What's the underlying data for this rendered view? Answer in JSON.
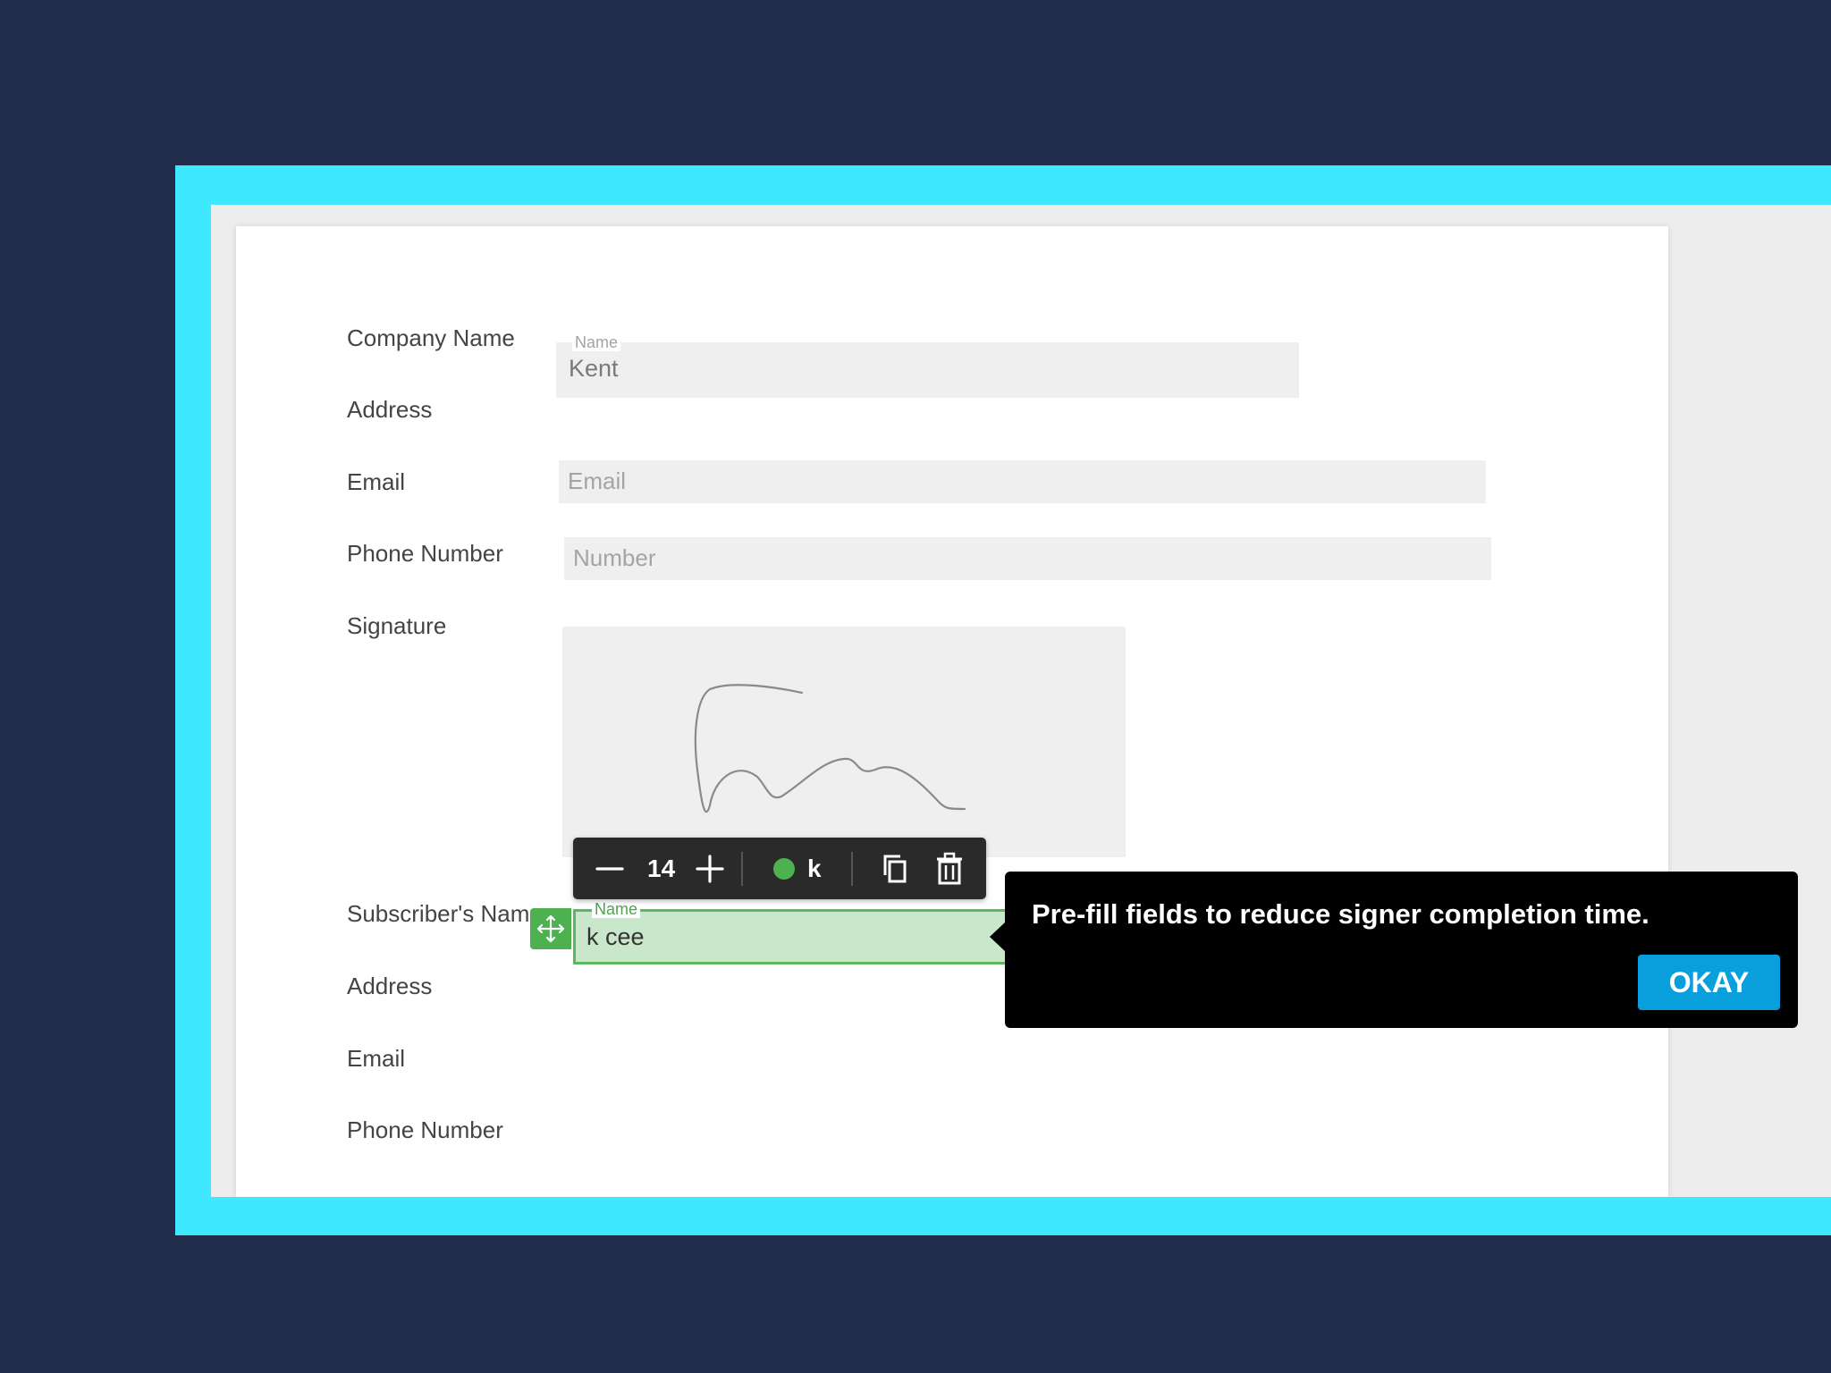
{
  "form": {
    "company_name_label": "Company Name",
    "company_field": {
      "caption": "Name",
      "value": "Kent"
    },
    "address_label": "Address",
    "email_label": "Email",
    "email_field": {
      "placeholder": "Email"
    },
    "phone_label": "Phone Number",
    "phone_field": {
      "placeholder": "Number"
    },
    "signature_label": "Signature",
    "subscriber_name_label": "Subscriber's Name",
    "subscriber_address_label": "Address",
    "subscriber_email_label": "Email",
    "subscriber_phone_label": "Phone Number"
  },
  "toolbar": {
    "font_size": "14",
    "signer_initial": "k",
    "signer_color": "#4db14f",
    "icons": [
      "minus-icon",
      "plus-icon",
      "copy-icon",
      "trash-icon"
    ]
  },
  "subscriber_name_field": {
    "caption": "Name",
    "value": "k cee"
  },
  "tooltip": {
    "message": "Pre-fill fields to reduce signer completion time.",
    "button_label": "OKAY"
  },
  "colors": {
    "background": "#212d4b",
    "frame": "#3ee8fe",
    "field_fill": "#efefef",
    "active_field_fill": "#c9e7cb",
    "active_field_border": "#5cb85c",
    "okay_button": "#099fdc"
  }
}
